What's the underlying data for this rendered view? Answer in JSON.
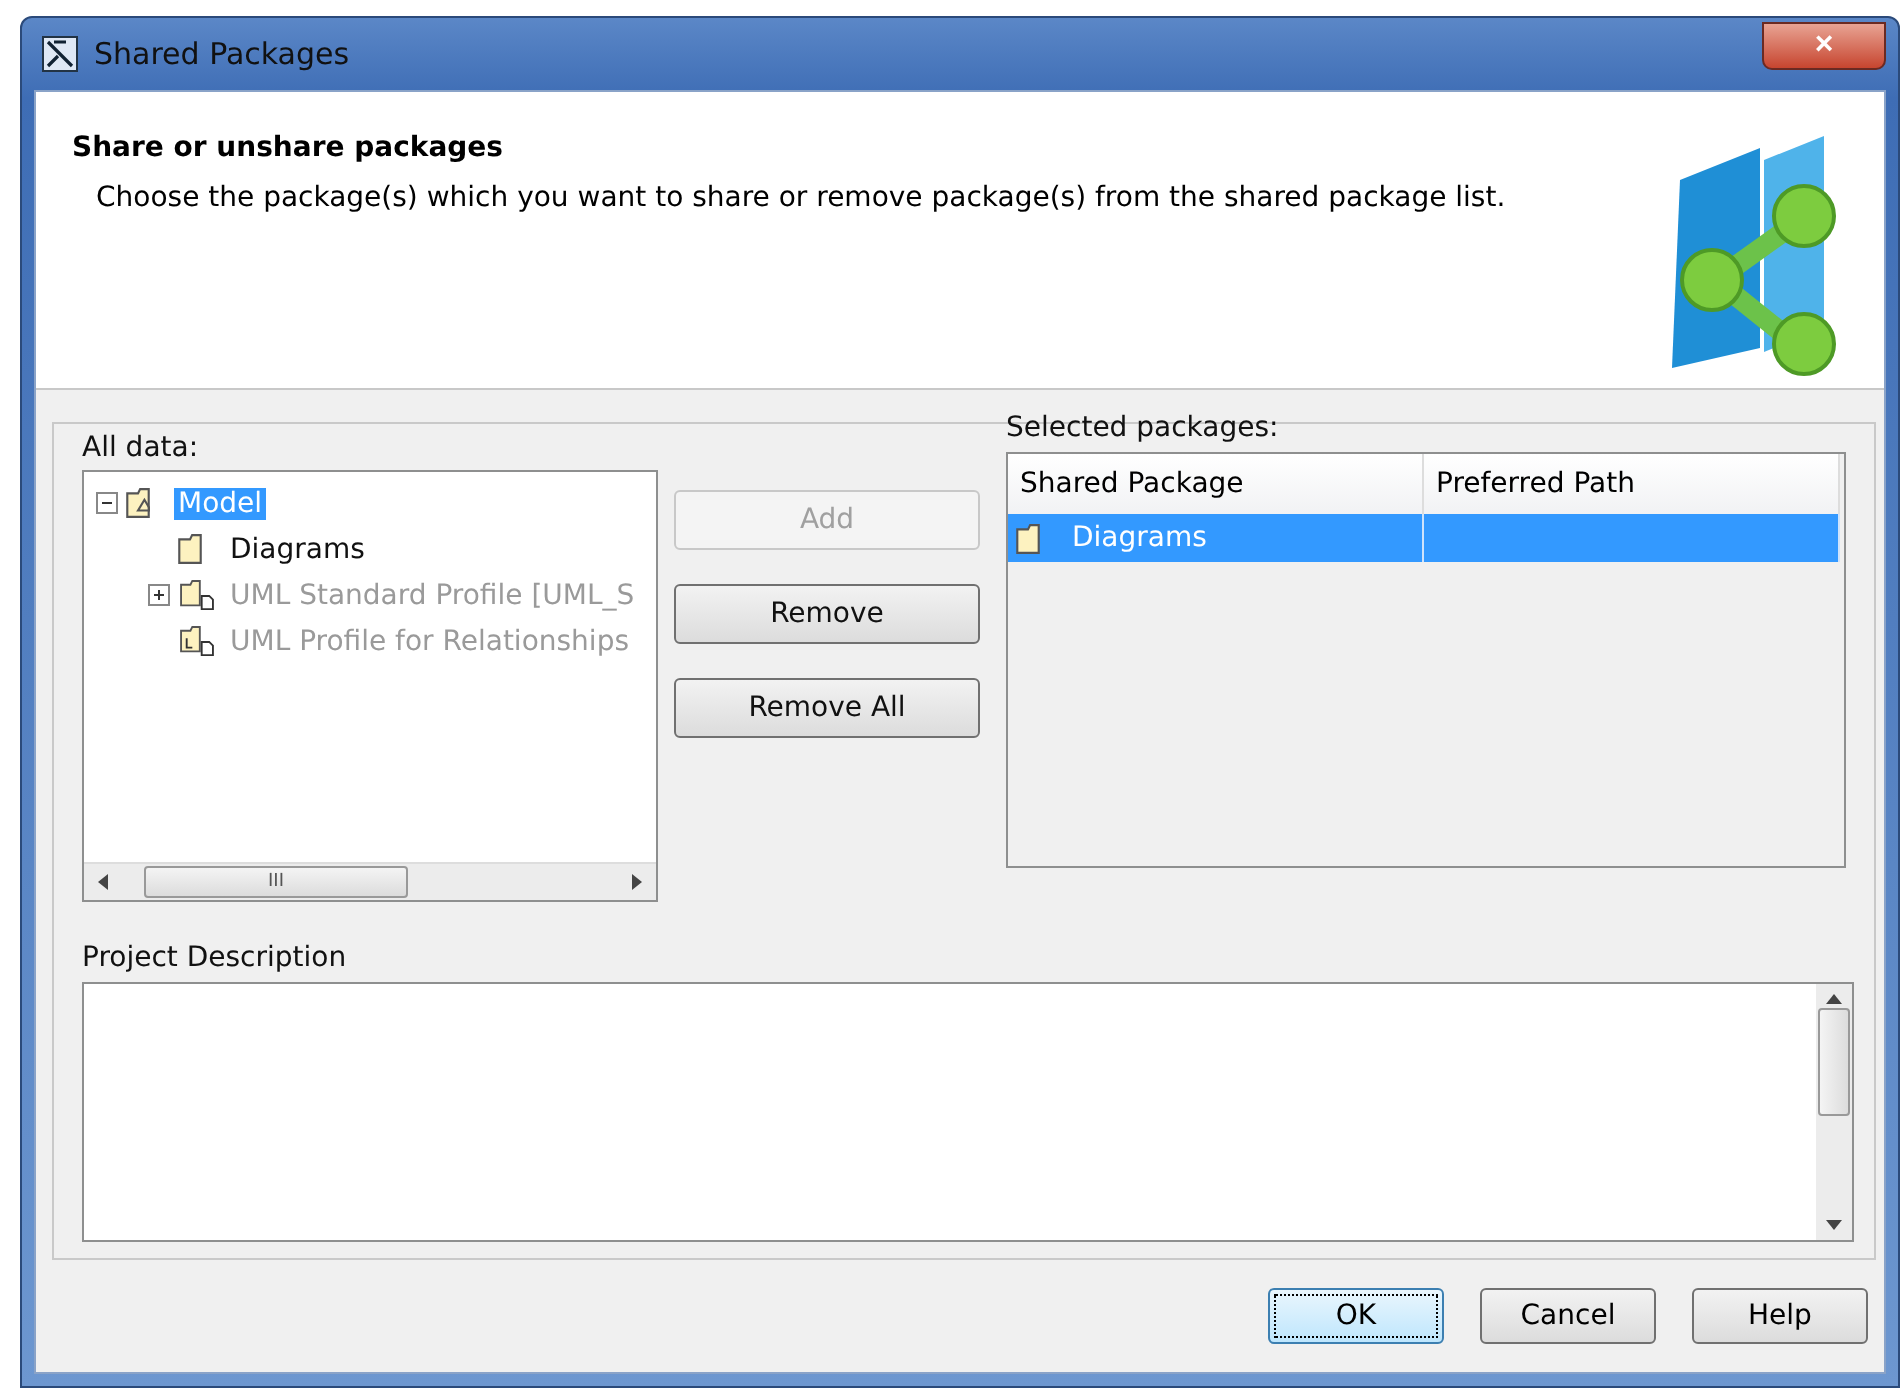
{
  "window": {
    "title": "Shared Packages",
    "close": "×"
  },
  "header": {
    "title": "Share or unshare packages",
    "description": "Choose the package(s) which you want to share or remove package(s) from the shared package list."
  },
  "all_data": {
    "label": "All data:",
    "tree": [
      {
        "label": "Model",
        "kind": "model",
        "selected": true,
        "disabled": false,
        "expanded": true,
        "children": [
          {
            "label": "Diagrams",
            "kind": "folder",
            "selected": false,
            "disabled": false
          },
          {
            "label": "UML Standard Profile [UML_S",
            "kind": "profile",
            "selected": false,
            "disabled": true,
            "expanded": false
          },
          {
            "label": "UML Profile for Relationships",
            "kind": "profile_l",
            "selected": false,
            "disabled": true
          }
        ]
      }
    ],
    "scroll_grip": "III"
  },
  "actions": [
    {
      "label": "Add",
      "disabled": true
    },
    {
      "label": "Remove",
      "disabled": false
    },
    {
      "label": "Remove All",
      "disabled": false
    }
  ],
  "selected_packages": {
    "label": "Selected packages:",
    "columns": [
      "Shared Package",
      "Preferred Path"
    ],
    "rows": [
      {
        "cells": [
          "Diagrams",
          ""
        ],
        "selected": true
      }
    ]
  },
  "project_description": {
    "label": "Project Description"
  },
  "buttons": [
    {
      "label": "OK",
      "default": true
    },
    {
      "label": "Cancel",
      "default": false
    },
    {
      "label": "Help",
      "default": false
    }
  ]
}
